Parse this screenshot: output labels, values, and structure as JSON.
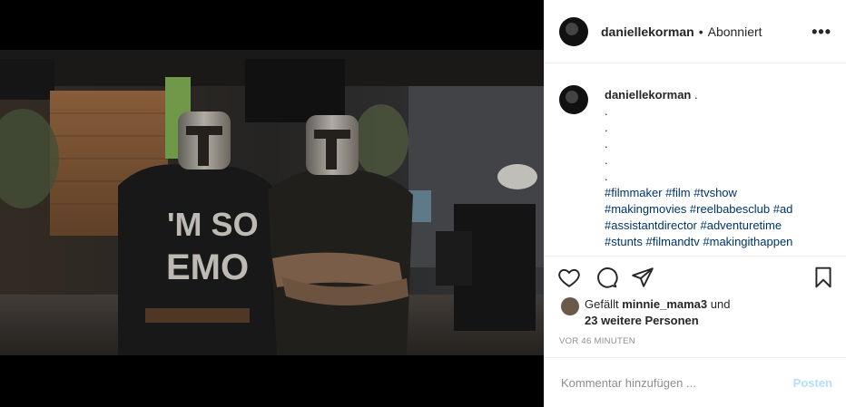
{
  "header": {
    "username": "daniellekorman",
    "separator": "•",
    "follow_state": "Abonniert",
    "more_label": "•••"
  },
  "caption": {
    "username": "daniellekorman",
    "first_text": ".",
    "dots": [
      ".",
      ".",
      ".",
      ".",
      "."
    ],
    "hashtag_lines": [
      "#filmmaker #film #tvshow",
      "#makingmovies #reelbabesclub #ad",
      "#assistantdirector #adventuretime",
      "#stunts #filmandtv #makingithappen"
    ]
  },
  "photo": {
    "shirt_text_line1": "'M SO",
    "shirt_text_line2": "EMO"
  },
  "actions": {
    "icons": [
      "heart-icon",
      "comment-icon",
      "share-icon",
      "bookmark-icon"
    ]
  },
  "likes": {
    "prefix": "Gefällt",
    "user": "minnie_mama3",
    "conj": "und",
    "others": "23 weitere Personen"
  },
  "timestamp": "VOR 46 MINUTEN",
  "comment": {
    "placeholder": "Kommentar hinzufügen ...",
    "post_label": "Posten"
  },
  "colors": {
    "hashtag": "#003569",
    "post_disabled": "#b2dffc",
    "muted": "#8e8e8e",
    "border": "#efefef"
  }
}
